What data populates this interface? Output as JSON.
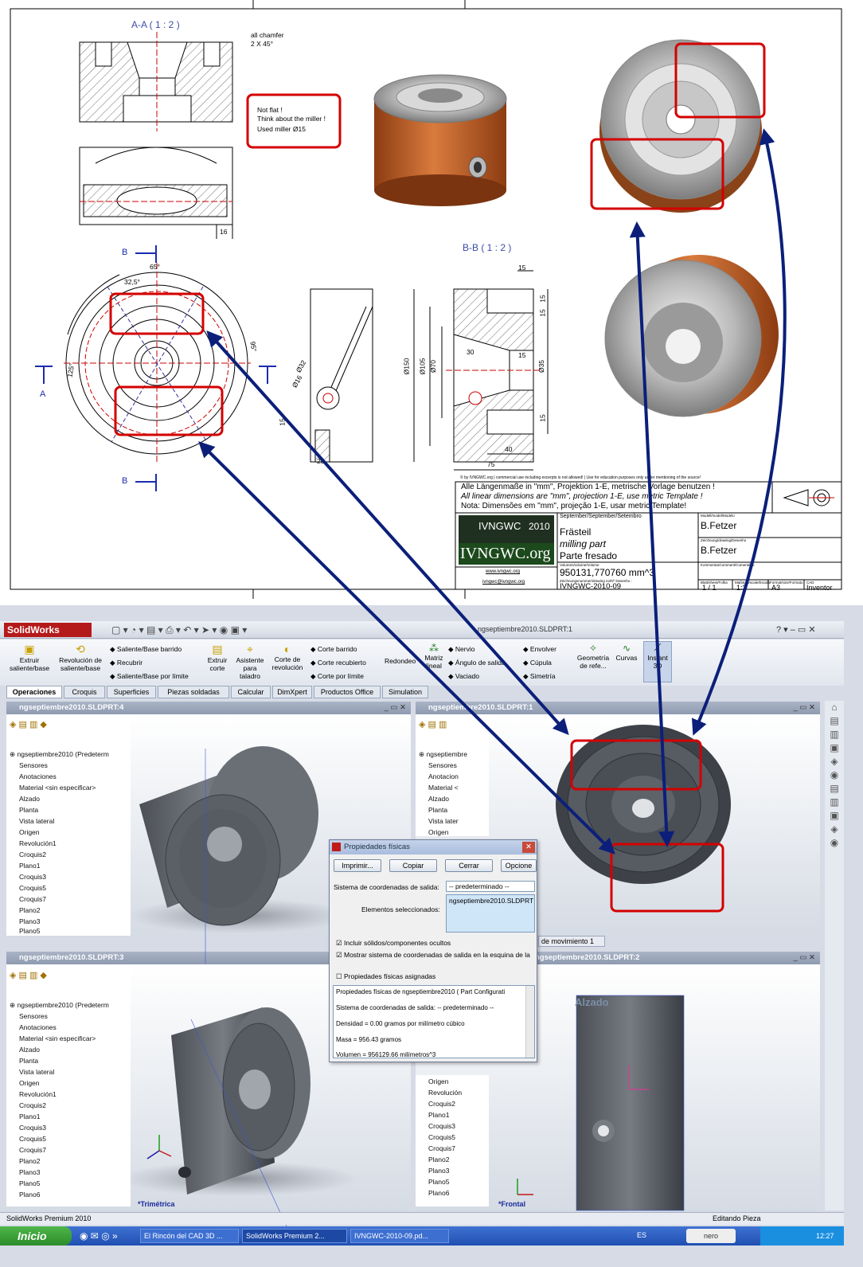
{
  "drawing": {
    "section_aa": "A-A ( 1 : 2 )",
    "section_bb": "B-B ( 1 : 2 )",
    "note_chamfer_1": "all chamfer",
    "note_chamfer_2": "2 X 45°",
    "note_notflat_1": "Not flat !",
    "note_notflat_2": "Think about the miller !",
    "note_notflat_3": "Used miller Ø15",
    "dims": {
      "d16": "16",
      "d65": "65°",
      "d325": "32,5°",
      "d95": "95°",
      "d125": "125°",
      "d15a": "15",
      "d15b": "15",
      "d15c": "15",
      "d15d": "15",
      "d15e": "15",
      "d30": "30",
      "d40": "40",
      "d75": "75",
      "d150": "Ø150",
      "d105": "Ø105",
      "d70": "Ø70",
      "d35": "Ø35",
      "d32": "Ø32",
      "d16b": "Ø16",
      "d25": "25",
      "d15f": "15"
    },
    "label_a": "A",
    "label_b_top": "B",
    "label_b_bottom": "B",
    "copyright": "© by IVNGWC.org | commercial use including excerpts is not allowed! | Use for education purposes only under mentioning of the source!",
    "note_de": "Alle Längenmaße in \"mm\", Projektion 1-E, metrische Vorlage benutzen !",
    "note_en": "All linear dimensions are \"mm\", projection 1-E, use metric Template !",
    "note_pt": "Nota: Dimensões em \"mm\", projeção 1-E, usar metric Template!",
    "date_header": "September/September/Setembro",
    "part_de": "Frästeil",
    "part_en": "milling part",
    "part_pt": "Parte fresado",
    "volume_header": "Volumen/volume/Volume",
    "volume": "950131,770760 mm^3",
    "drawing_no_header": "Zeichnungsnummer/drawing no/Nº Desenho :",
    "drawing_no": "IVNGWC-2010-09",
    "model_header": "Modell/model/Modelo",
    "model_by": "B.Fetzer",
    "drawn_header": "Zeichnung/drawing/Desenho",
    "drawn_by": "B.Fetzer",
    "comment_header": "Kommentar/comment/Comentário",
    "sheet_label": "Blatt/sheet/Folha",
    "sheet": "1 / 1",
    "scale_label": "Maßstab/scale/Escala",
    "scale": "1:2",
    "format_label": "Format/size/Formato",
    "format": "A3",
    "cad_label": "CAD",
    "cad": "Inventor",
    "logo_text": "IVNGWC",
    "logo_year": "2010",
    "logo_site": "IVNGWC.org",
    "web": "www.ivngwc.org",
    "mail": "ivngwc@ivngwc.org"
  },
  "app": {
    "brand": "SolidWorks",
    "title": "ngseptiembre2010.SLDPRT:1",
    "toolbar_left": [
      {
        "label": "Extruir saliente/base"
      },
      {
        "label": "Revolución de saliente/base"
      }
    ],
    "toolbar_mid_col": [
      "Saliente/Base barrido",
      "Recubrir",
      "Saliente/Base por límite"
    ],
    "toolbar_cut": [
      {
        "label": "Extruir corte"
      },
      {
        "label": "Asistente para taladro"
      },
      {
        "label": "Corte de revolución"
      }
    ],
    "toolbar_cut_col": [
      "Corte barrido",
      "Corte recubierto",
      "Corte por límite"
    ],
    "toolbar_redondeo": "Redondeo",
    "toolbar_matriz": "Matriz lineal",
    "toolbar_nervio_col": [
      "Nervio",
      "Ángulo de salida",
      "Vaciado"
    ],
    "toolbar_env_col": [
      "Envolver",
      "Cúpula",
      "Simetría"
    ],
    "toolbar_geo": "Geometría de refe...",
    "toolbar_curvas": "Curvas",
    "toolbar_instant": "Instant 3D",
    "tabs": [
      "Operaciones",
      "Croquis",
      "Superficies",
      "Piezas soldadas",
      "Calcular",
      "DimXpert",
      "Productos Office",
      "Simulation"
    ],
    "viewports": {
      "tl_title": "ngseptiembre2010.SLDPRT:4",
      "tr_title": "ngseptiembre2010.SLDPRT:1",
      "bl_title": "ngseptiembre2010.SLDPRT:3",
      "br_title": "ngseptiembre2010.SLDPRT:2",
      "bl_label": "*Trimétrica",
      "br_label": "*Frontal",
      "plane_alzado": "Alzado",
      "motion_tab": "de movimiento 1"
    },
    "tree_root": "ngseptiembre2010 (Predeterm",
    "tree_root_short": "ngseptiembre",
    "tree_items": [
      "Sensores",
      "Anotaciones",
      "Material <sin especificar>",
      "Alzado",
      "Planta",
      "Vista lateral",
      "Origen",
      "Revolución1",
      "Croquis2",
      "Plano1",
      "Croquis3",
      "Croquis5",
      "Croquis7",
      "Plano2",
      "Plano3",
      "Plano5",
      "Plano6"
    ],
    "tree_items_tr": [
      "Sensores",
      "Anotacion",
      "Material <",
      "Alzado",
      "Planta",
      "Vista later",
      "Origen"
    ],
    "tree_items_br": [
      "Origen",
      "Revolución",
      "Croquis2",
      "Plano1",
      "Croquis3",
      "Croquis5",
      "Croquis7",
      "Plano2",
      "Plano3",
      "Plano5",
      "Plano6"
    ],
    "dialog": {
      "title": "Propiedades físicas",
      "btn_print": "Imprimir...",
      "btn_copy": "Copiar",
      "btn_close": "Cerrar",
      "btn_options": "Opcione",
      "coord_label": "Sistema de coordenadas de salida:",
      "coord_value": "-- predeterminado --",
      "sel_label": "Elementos seleccionados:",
      "sel_value": "ngseptiembre2010.SLDPRT",
      "chk1": "Incluir sólidos/componentes ocultos",
      "chk2": "Mostrar sistema de coordenadas de salida en la esquina de la",
      "chk3": "Propiedades físicas asignadas",
      "out1": "Propiedades físicas de ngseptiembre2010 ( Part Configurati",
      "out2": "Sistema de coordenadas de salida: -- predeterminado --",
      "out3": "Densidad = 0.00 gramos por milímetro cúbico",
      "out4": "Masa = 956.43 gramos",
      "out5": "Volumen = 956129.66 milímetros^3"
    },
    "status_left": "SolidWorks Premium 2010",
    "status_right": "Editando Pieza",
    "taskbar": {
      "start": "Inicio",
      "items": [
        "El Rincón del CAD 3D ...",
        "SolidWorks Premium 2...",
        "IVNGWC-2010-09.pd..."
      ],
      "lang": "ES",
      "nero": "nero",
      "time": "12:27"
    }
  },
  "colors": {
    "highlight": "#d40000",
    "arrow": "#0b1f7a",
    "orange": "#c4632b"
  }
}
